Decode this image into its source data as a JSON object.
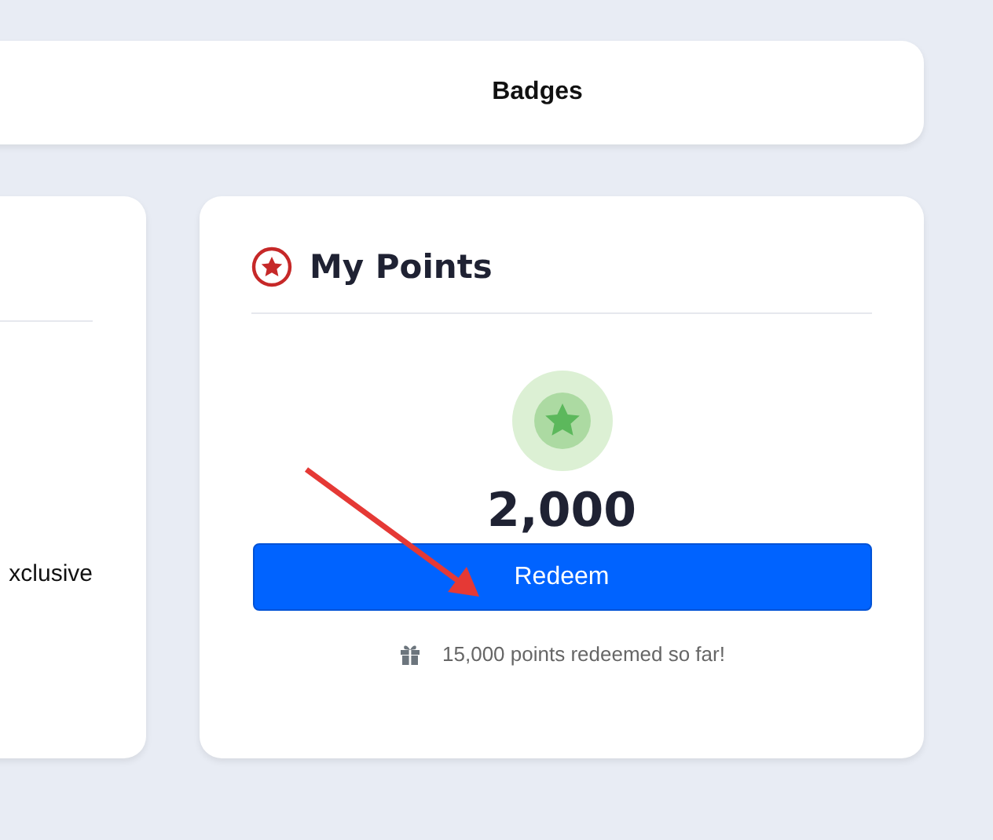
{
  "top_bar": {
    "tab": "Badges"
  },
  "left_card": {
    "text": "xclusive"
  },
  "points_card": {
    "title": "My Points",
    "points": "2,000",
    "button": "Redeem",
    "note": "15,000 points redeemed so far!"
  }
}
